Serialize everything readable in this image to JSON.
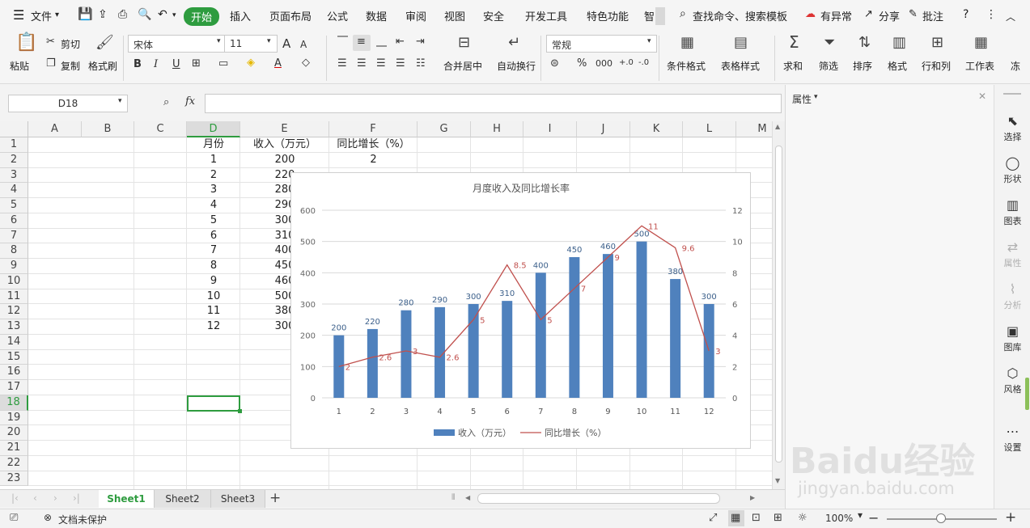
{
  "menu": {
    "file_label": "文件",
    "items": [
      "开始",
      "插入",
      "页面布局",
      "公式",
      "数据",
      "审阅",
      "视图",
      "安全",
      "开发工具",
      "特色功能",
      "智"
    ],
    "search_label": "查找命令、搜索模板",
    "exception_label": "有异常",
    "share_label": "分享",
    "comment_label": "批注"
  },
  "ribbon": {
    "paste": "粘贴",
    "cut": "剪切",
    "copy": "复制",
    "format_painter": "格式刷",
    "font_name": "宋体",
    "font_size": "11",
    "font_grow": "A",
    "font_shrink": "A",
    "bold": "B",
    "italic": "I",
    "underline": "U",
    "merge_center": "合并居中",
    "wrap_text": "自动换行",
    "number_format": "常规",
    "conditional_format": "条件格式",
    "table_style": "表格样式",
    "sum": "求和",
    "filter": "筛选",
    "sort": "排序",
    "format": "格式",
    "row_col": "行和列",
    "worksheet": "工作表",
    "freeze": "冻"
  },
  "formula_bar": {
    "name_box": "D18",
    "fx": "fx",
    "value": ""
  },
  "grid": {
    "columns": [
      "A",
      "B",
      "C",
      "D",
      "E",
      "F",
      "G",
      "H",
      "I",
      "J",
      "K",
      "L",
      "M"
    ],
    "rows": [
      "1",
      "2",
      "3",
      "4",
      "5",
      "6",
      "7",
      "8",
      "9",
      "10",
      "11",
      "12",
      "13",
      "14",
      "15",
      "16",
      "17",
      "18",
      "19",
      "20",
      "21",
      "22",
      "23"
    ],
    "headers": {
      "d": "月份",
      "e": "收入（万元）",
      "f": "同比增长（%）"
    },
    "col_d": [
      "1",
      "2",
      "3",
      "4",
      "5",
      "6",
      "7",
      "8",
      "9",
      "10",
      "11",
      "12"
    ],
    "col_e": [
      "200",
      "220",
      "280",
      "290",
      "300",
      "310",
      "400",
      "450",
      "460",
      "500",
      "380",
      "300"
    ],
    "f2": "2",
    "selected_cell": "D18"
  },
  "chart_data": {
    "type": "bar",
    "title": "月度收入及同比增长率",
    "categories": [
      "1",
      "2",
      "3",
      "4",
      "5",
      "6",
      "7",
      "8",
      "9",
      "10",
      "11",
      "12"
    ],
    "series": [
      {
        "name": "收入（万元）",
        "type": "bar",
        "axis": "left",
        "color": "#4f81bd",
        "values": [
          200,
          220,
          280,
          290,
          300,
          310,
          400,
          450,
          460,
          500,
          380,
          300
        ]
      },
      {
        "name": "同比增长（%）",
        "type": "line",
        "axis": "right",
        "color": "#c0504d",
        "values": [
          2,
          2.6,
          3,
          2.6,
          5,
          8.5,
          5,
          7,
          9,
          11,
          9.6,
          3
        ]
      }
    ],
    "left_axis": {
      "ylim": [
        0,
        600
      ],
      "ticks": [
        "0",
        "100",
        "200",
        "300",
        "400",
        "500",
        "600"
      ]
    },
    "right_axis": {
      "ylim": [
        0,
        12
      ],
      "ticks": [
        "0",
        "2",
        "4",
        "6",
        "8",
        "10",
        "12"
      ]
    },
    "legend": "bottom",
    "grid": true
  },
  "sheets": [
    "Sheet1",
    "Sheet2",
    "Sheet3"
  ],
  "active_sheet": "Sheet1",
  "status": {
    "protect_label": "文档未保护",
    "zoom": "100%"
  },
  "props_panel": {
    "title": "属性"
  },
  "side_tools": [
    {
      "label": "选择",
      "icon": "cursor-icon",
      "enabled": true
    },
    {
      "label": "形状",
      "icon": "shapes-icon",
      "enabled": true
    },
    {
      "label": "图表",
      "icon": "chart-icon",
      "enabled": true
    },
    {
      "label": "属性",
      "icon": "properties-icon",
      "enabled": false
    },
    {
      "label": "分析",
      "icon": "analysis-icon",
      "enabled": false
    },
    {
      "label": "图库",
      "icon": "gallery-icon",
      "enabled": true
    },
    {
      "label": "风格",
      "icon": "style-icon",
      "enabled": true
    },
    {
      "label": "设置",
      "icon": "settings-icon",
      "enabled": true
    }
  ],
  "watermark": {
    "brand": "Baidu经验",
    "url": "jingyan.baidu.com"
  }
}
